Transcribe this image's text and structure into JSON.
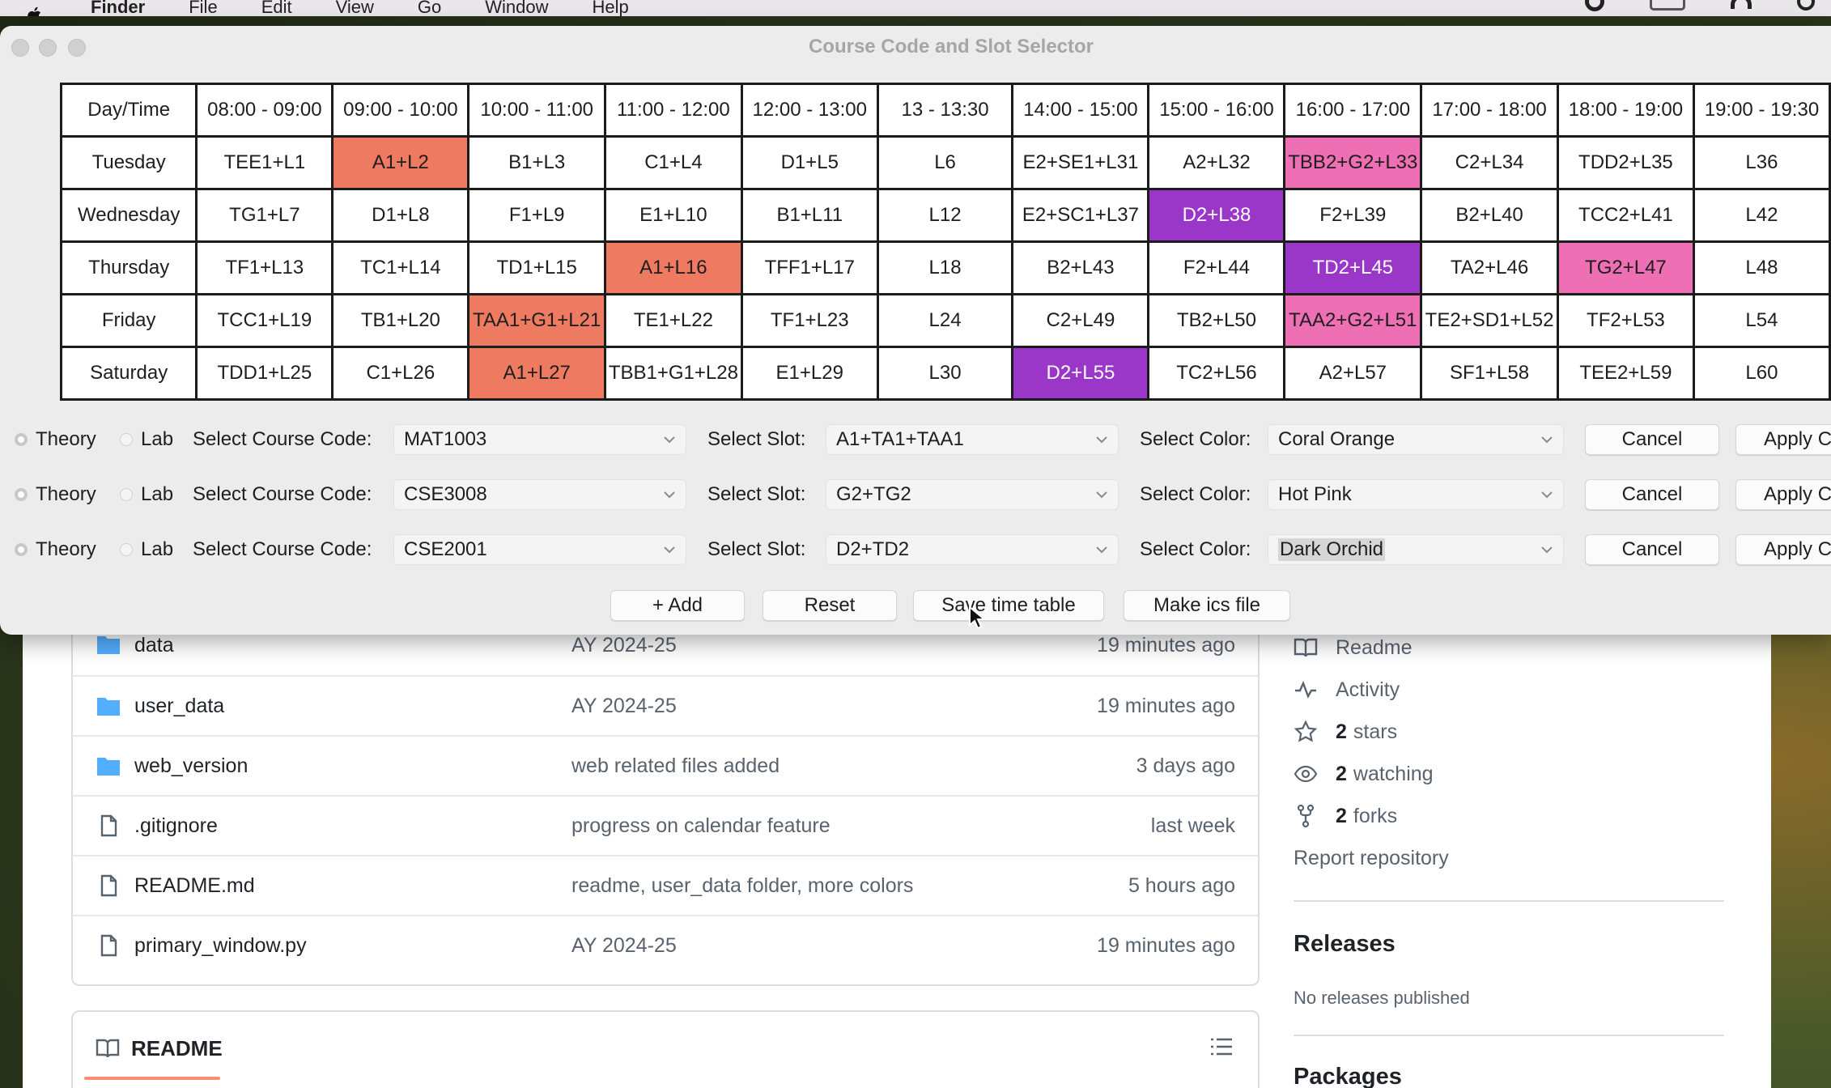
{
  "menubar": {
    "app_name": "Finder",
    "menus": [
      "File",
      "Edit",
      "View",
      "Go",
      "Window",
      "Help"
    ]
  },
  "window": {
    "title": "Course Code and Slot Selector"
  },
  "timetable": {
    "header": [
      "Day/Time",
      "08:00 - 09:00",
      "09:00 - 10:00",
      "10:00 - 11:00",
      "11:00 - 12:00",
      "12:00 - 13:00",
      "13 - 13:30",
      "14:00 - 15:00",
      "15:00 - 16:00",
      "16:00 - 17:00",
      "17:00 - 18:00",
      "18:00 - 19:00",
      "19:00 - 19:30"
    ],
    "rows": [
      {
        "day": "Tuesday",
        "cells": [
          "TEE1+L1",
          "A1+L2",
          "B1+L3",
          "C1+L4",
          "D1+L5",
          "L6",
          "E2+SE1+L31",
          "A2+L32",
          "TBB2+G2+L33",
          "C2+L34",
          "TDD2+L35",
          "L36"
        ],
        "colors": [
          "",
          "#ee7a62",
          "",
          "",
          "",
          "",
          "",
          "",
          "#ee6fb4",
          "",
          "",
          ""
        ]
      },
      {
        "day": "Wednesday",
        "cells": [
          "TG1+L7",
          "D1+L8",
          "F1+L9",
          "E1+L10",
          "B1+L11",
          "L12",
          "E2+SC1+L37",
          "D2+L38",
          "F2+L39",
          "B2+L40",
          "TCC2+L41",
          "L42"
        ],
        "colors": [
          "",
          "",
          "",
          "",
          "",
          "",
          "",
          "#9a36c8",
          "",
          "",
          "",
          ""
        ]
      },
      {
        "day": "Thursday",
        "cells": [
          "TF1+L13",
          "TC1+L14",
          "TD1+L15",
          "A1+L16",
          "TFF1+L17",
          "L18",
          "B2+L43",
          "F2+L44",
          "TD2+L45",
          "TA2+L46",
          "TG2+L47",
          "L48"
        ],
        "colors": [
          "",
          "",
          "",
          "#ee7a62",
          "",
          "",
          "",
          "",
          "#9a36c8",
          "",
          "#ee6fb4",
          ""
        ]
      },
      {
        "day": "Friday",
        "cells": [
          "TCC1+L19",
          "TB1+L20",
          "TAA1+G1+L21",
          "TE1+L22",
          "TF1+L23",
          "L24",
          "C2+L49",
          "TB2+L50",
          "TAA2+G2+L51",
          "TE2+SD1+L52",
          "TF2+L53",
          "L54"
        ],
        "colors": [
          "",
          "",
          "#ee7a62",
          "",
          "",
          "",
          "",
          "",
          "#ee6fb4",
          "",
          "",
          ""
        ]
      },
      {
        "day": "Saturday",
        "cells": [
          "TDD1+L25",
          "C1+L26",
          "A1+L27",
          "TBB1+G1+L28",
          "E1+L29",
          "L30",
          "D2+L55",
          "TC2+L56",
          "A2+L57",
          "SF1+L58",
          "TEE2+L59",
          "L60"
        ],
        "colors": [
          "",
          "",
          "#ee7a62",
          "",
          "",
          "",
          "#9a36c8",
          "",
          "",
          "",
          "",
          ""
        ]
      }
    ]
  },
  "course_rows": [
    {
      "theory_label": "Theory",
      "lab_label": "Lab",
      "course_label": "Select Course Code:",
      "course_value": "MAT1003",
      "slot_label": "Select Slot:",
      "slot_value": "A1+TA1+TAA1",
      "color_label": "Select Color:",
      "color_value": "Coral Orange",
      "cancel_label": "Cancel",
      "apply_label": "Apply C"
    },
    {
      "theory_label": "Theory",
      "lab_label": "Lab",
      "course_label": "Select Course Code:",
      "course_value": "CSE3008",
      "slot_label": "Select Slot:",
      "slot_value": "G2+TG2",
      "color_label": "Select Color:",
      "color_value": "Hot Pink",
      "cancel_label": "Cancel",
      "apply_label": "Apply C"
    },
    {
      "theory_label": "Theory",
      "lab_label": "Lab",
      "course_label": "Select Course Code:",
      "course_value": "CSE2001",
      "slot_label": "Select Slot:",
      "slot_value": "D2+TD2",
      "color_label": "Select Color:",
      "color_value": "Dark Orchid",
      "cancel_label": "Cancel",
      "apply_label": "Apply C"
    }
  ],
  "actions": {
    "add_label": "+ Add",
    "reset_label": "Reset",
    "save_label": "Save time table",
    "ics_label": "Make ics file"
  },
  "repo_files": [
    {
      "icon": "folder-icon",
      "name": "data",
      "message": "AY 2024-25",
      "time": "19 minutes ago"
    },
    {
      "icon": "folder-icon",
      "name": "user_data",
      "message": "AY 2024-25",
      "time": "19 minutes ago"
    },
    {
      "icon": "folder-icon",
      "name": "web_version",
      "message": "web related files added",
      "time": "3 days ago"
    },
    {
      "icon": "file-icon",
      "name": ".gitignore",
      "message": "progress on calendar feature",
      "time": "last week"
    },
    {
      "icon": "file-icon",
      "name": "README.md",
      "message": "readme, user_data folder, more colors",
      "time": "5 hours ago"
    },
    {
      "icon": "file-icon",
      "name": "primary_window.py",
      "message": "AY 2024-25",
      "time": "19 minutes ago"
    }
  ],
  "readme": {
    "title": "README"
  },
  "sidebar": {
    "readme_label": "Readme",
    "activity_label": "Activity",
    "stars_count": "2",
    "stars_label": "stars",
    "watching_count": "2",
    "watching_label": "watching",
    "forks_count": "2",
    "forks_label": "forks",
    "report_label": "Report repository",
    "releases_heading": "Releases",
    "releases_note": "No releases published",
    "packages_heading": "Packages"
  },
  "colors": {
    "coral_orange": "#ee7a62",
    "hot_pink": "#ee6fb4",
    "dark_orchid": "#9a36c8",
    "github_accent": "#fd8c73",
    "folder_blue": "#54aeff"
  }
}
